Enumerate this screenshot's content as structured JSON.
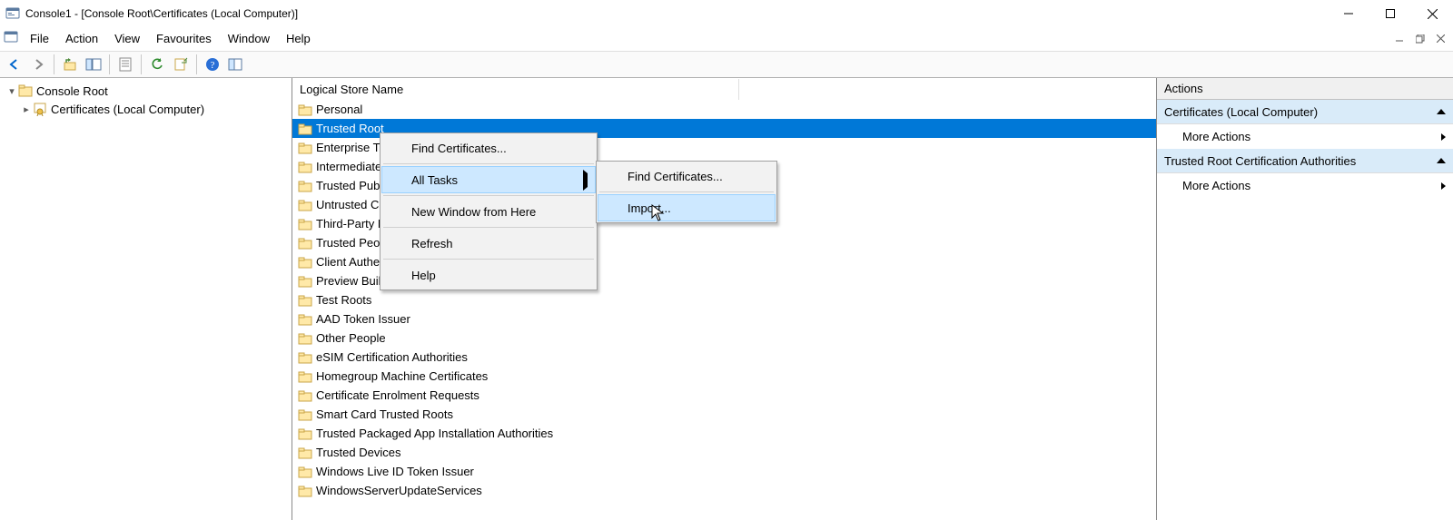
{
  "title": "Console1 - [Console Root\\Certificates (Local Computer)]",
  "menubar": {
    "file": "File",
    "action": "Action",
    "view": "View",
    "favourites": "Favourites",
    "window": "Window",
    "help": "Help"
  },
  "tree": {
    "root": "Console Root",
    "child": "Certificates (Local Computer)"
  },
  "column_header": "Logical Store Name",
  "stores": [
    "Personal",
    "Trusted Root Certification Authorities",
    "Enterprise Trust",
    "Intermediate Certification Authorities",
    "Trusted Publishers",
    "Untrusted Certificates",
    "Third-Party Root Certification Authorities",
    "Trusted People",
    "Client Authentication Issuers",
    "Preview Build Roots",
    "Test Roots",
    "AAD Token Issuer",
    "Other People",
    "eSIM Certification Authorities",
    "Homegroup Machine Certificates",
    "Certificate Enrolment Requests",
    "Smart Card Trusted Roots",
    "Trusted Packaged App Installation Authorities",
    "Trusted Devices",
    "Windows Live ID Token Issuer",
    "WindowsServerUpdateServices"
  ],
  "selected_store_index": 1,
  "selected_store_short": "Trusted Root",
  "context_menu": {
    "find": "Find Certificates...",
    "all_tasks": "All Tasks",
    "new_window": "New Window from Here",
    "refresh": "Refresh",
    "help": "Help"
  },
  "submenu": {
    "find": "Find Certificates...",
    "import": "Import..."
  },
  "actions_panel": {
    "title": "Actions",
    "section1": "Certificates (Local Computer)",
    "section2": "Trusted Root Certification Authorities",
    "more": "More Actions"
  }
}
